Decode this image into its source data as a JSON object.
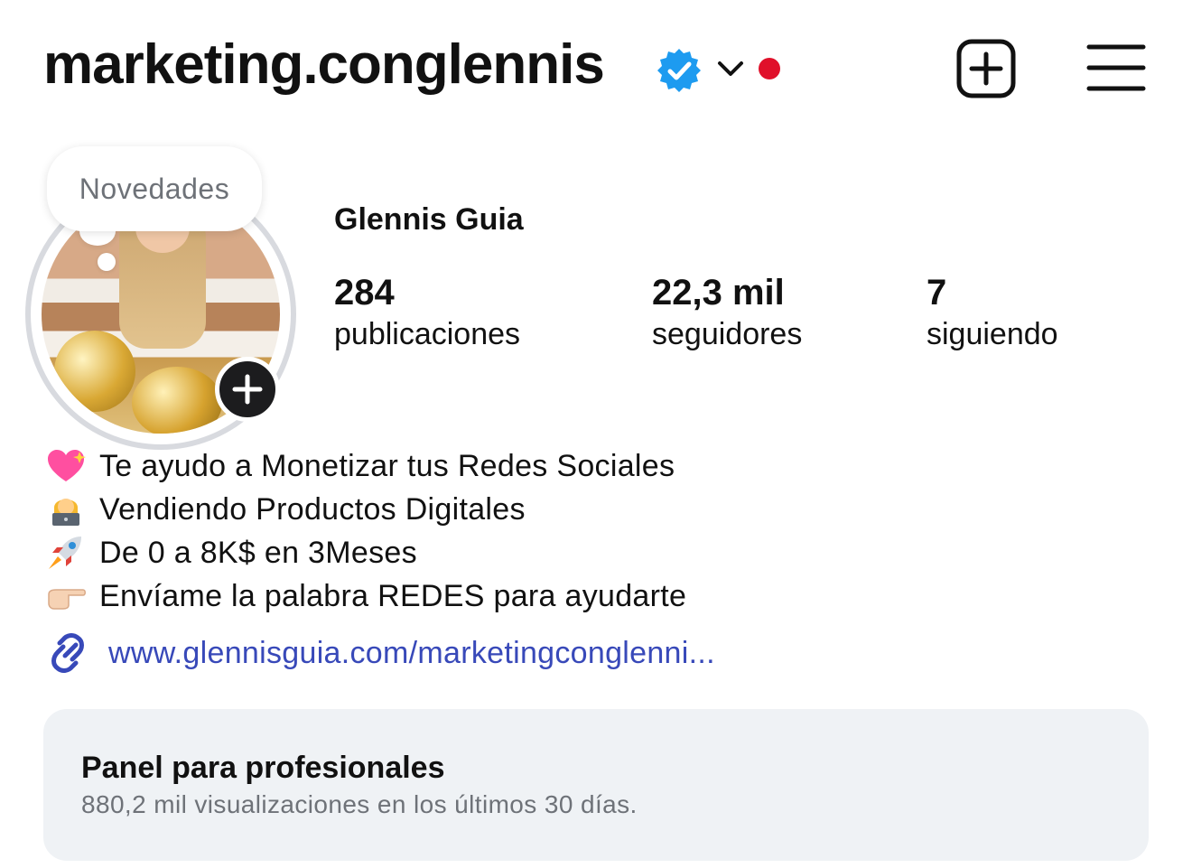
{
  "header": {
    "username": "marketing.conglennis",
    "verified_icon": "verified-badge-icon",
    "chevron_icon": "chevron-down-icon",
    "add_icon": "plus-square-icon",
    "menu_icon": "hamburger-menu-icon"
  },
  "avatar": {
    "note_bubble": "Novedades",
    "add_icon": "plus-icon"
  },
  "profile": {
    "full_name": "Glennis Guia",
    "stats": {
      "posts": {
        "value": "284",
        "label": "publicaciones"
      },
      "followers": {
        "value": "22,3 mil",
        "label": "seguidores"
      },
      "following": {
        "value": "7",
        "label": "siguiendo"
      }
    }
  },
  "bio": {
    "lines": [
      {
        "emoji": "sparkling-heart-icon",
        "text": "Te ayudo a Monetizar tus Redes Sociales"
      },
      {
        "emoji": "person-laptop-icon",
        "text": "Vendiendo Productos Digitales"
      },
      {
        "emoji": "rocket-icon",
        "text": "De 0 a 8K$ en 3Meses"
      },
      {
        "emoji": "pointing-hand-icon",
        "text": "Envíame la palabra REDES para ayudarte"
      }
    ]
  },
  "link": {
    "icon": "link-icon",
    "url": "www.glennisguia.com/marketingconglenni..."
  },
  "pro_panel": {
    "title": "Panel para profesionales",
    "subtitle": "880,2 mil visualizaciones en los últimos 30 días."
  },
  "colors": {
    "verified_blue": "#1d9bf0",
    "link_blue": "#3849b9",
    "notification_red": "#e0102a",
    "panel_bg": "#eff2f5"
  }
}
